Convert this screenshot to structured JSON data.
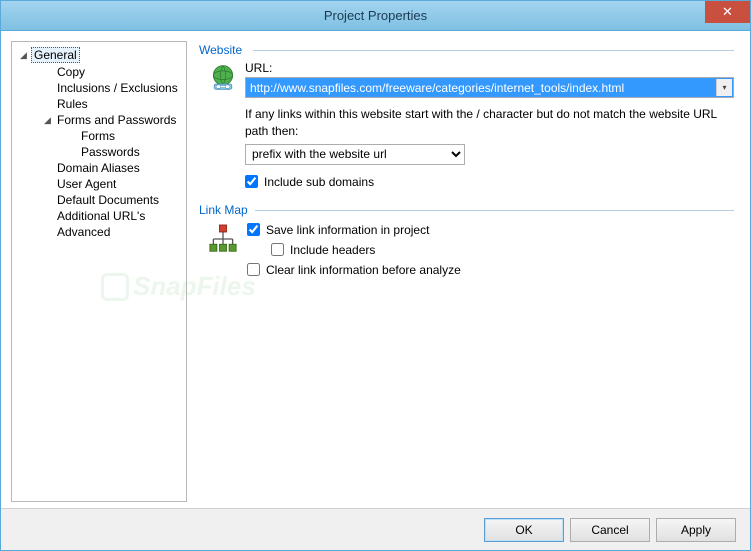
{
  "window": {
    "title": "Project Properties",
    "close": "✕"
  },
  "tree": {
    "items": [
      {
        "label": "General",
        "indent": 0,
        "expander": "◢",
        "selected": true
      },
      {
        "label": "Copy",
        "indent": 1,
        "expander": ""
      },
      {
        "label": "Inclusions / Exclusions",
        "indent": 1,
        "expander": ""
      },
      {
        "label": "Rules",
        "indent": 1,
        "expander": ""
      },
      {
        "label": "Forms and Passwords",
        "indent": 1,
        "expander": "◢"
      },
      {
        "label": "Forms",
        "indent": 2,
        "expander": ""
      },
      {
        "label": "Passwords",
        "indent": 2,
        "expander": ""
      },
      {
        "label": "Domain Aliases",
        "indent": 1,
        "expander": ""
      },
      {
        "label": "User Agent",
        "indent": 1,
        "expander": ""
      },
      {
        "label": "Default Documents",
        "indent": 1,
        "expander": ""
      },
      {
        "label": "Additional URL's",
        "indent": 1,
        "expander": ""
      },
      {
        "label": "Advanced",
        "indent": 1,
        "expander": ""
      }
    ]
  },
  "website": {
    "heading": "Website",
    "url_label": "URL:",
    "url_value": "http://www.snapfiles.com/freeware/categories/internet_tools/index.html",
    "info_text": "If any links within this website start with the / character but do not match the website URL path then:",
    "prefix_selected": "prefix with the website url",
    "include_subdomains_label": "Include sub domains",
    "include_subdomains_checked": true
  },
  "linkmap": {
    "heading": "Link Map",
    "save_label": "Save link information in project",
    "save_checked": true,
    "headers_label": "Include headers",
    "headers_checked": false,
    "clear_label": "Clear link information before analyze",
    "clear_checked": false
  },
  "buttons": {
    "ok": "OK",
    "cancel": "Cancel",
    "apply": "Apply"
  },
  "watermark": "SnapFiles"
}
